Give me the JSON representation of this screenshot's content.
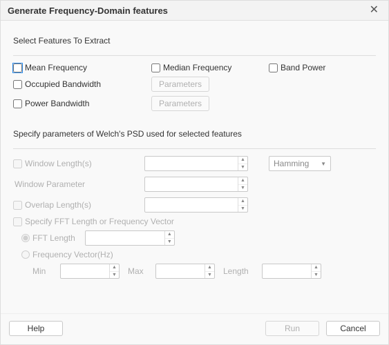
{
  "title": "Generate Frequency-Domain features",
  "section1_label": "Select Features To Extract",
  "features": {
    "mean_frequency": "Mean Frequency",
    "median_frequency": "Median Frequency",
    "band_power": "Band Power",
    "occupied_bandwidth": "Occupied Bandwidth",
    "power_bandwidth": "Power Bandwidth"
  },
  "buttons": {
    "parameters": "Parameters",
    "help": "Help",
    "run": "Run",
    "cancel": "Cancel"
  },
  "section2_label": "Specify parameters of Welch's PSD used for selected features",
  "params": {
    "window_length": "Window Length(s)",
    "window_parameter": "Window Parameter",
    "overlap_length": "Overlap Length(s)",
    "specify_fft": "Specify FFT Length or Frequency Vector",
    "fft_length": "FFT Length",
    "frequency_vector": "Frequency Vector(Hz)",
    "min": "Min",
    "max": "Max",
    "length": "Length",
    "window_type_selected": "Hamming"
  },
  "values": {
    "window_length": "",
    "window_parameter": "",
    "overlap_length": "",
    "fft_length": "",
    "min": "",
    "max": "",
    "length": ""
  }
}
